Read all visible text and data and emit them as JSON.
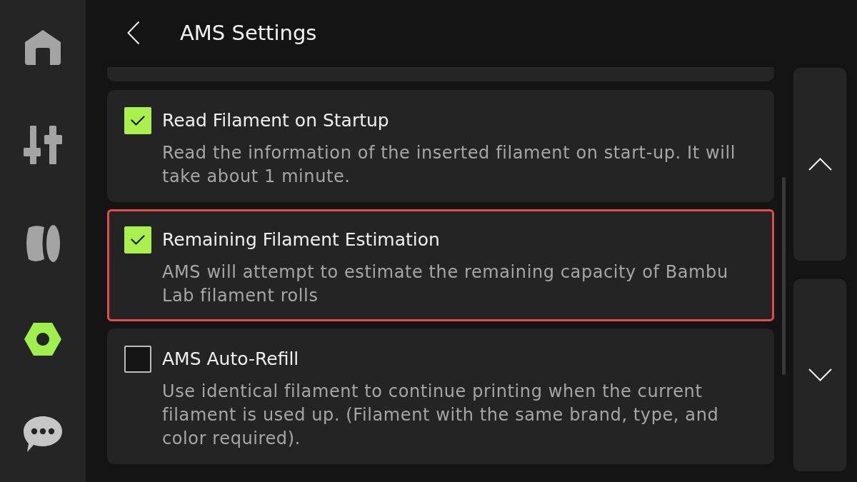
{
  "sidebar": {
    "items": [
      {
        "kind": "home",
        "selected": false
      },
      {
        "kind": "controls",
        "selected": false
      },
      {
        "kind": "filament",
        "selected": false
      },
      {
        "kind": "settings",
        "selected": true
      },
      {
        "kind": "messages",
        "selected": false
      }
    ]
  },
  "header": {
    "title": "AMS Settings"
  },
  "settings": [
    {
      "title": "Read Filament on Startup",
      "description": "Read the information of the inserted filament on start-up. It will take about 1 minute.",
      "checked": true,
      "highlighted": false
    },
    {
      "title": "Remaining Filament Estimation",
      "description": "AMS will attempt to estimate the remaining capacity of Bambu Lab filament rolls",
      "checked": true,
      "highlighted": true
    },
    {
      "title": "AMS Auto-Refill",
      "description": "Use identical filament to continue printing when the current filament is used up. (Filament with the same brand, type, and color required).",
      "checked": false,
      "highlighted": false
    }
  ]
}
